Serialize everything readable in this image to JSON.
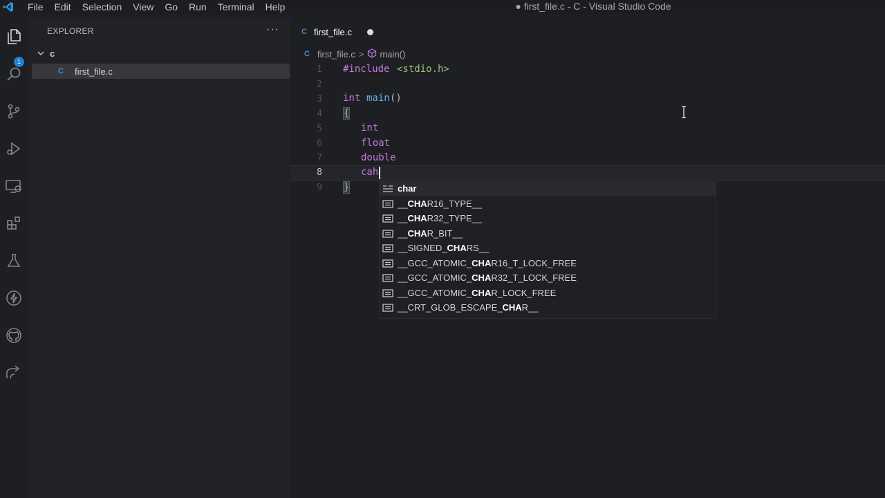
{
  "window": {
    "title": "● first_file.c - C - Visual Studio Code"
  },
  "menu": [
    "File",
    "Edit",
    "Selection",
    "View",
    "Go",
    "Run",
    "Terminal",
    "Help"
  ],
  "activity_bar": {
    "items": [
      "files-icon",
      "search-icon",
      "source-control-icon",
      "run-debug-icon",
      "remote-explorer-icon",
      "extensions-icon",
      "testing-icon",
      "lightning-icon",
      "github-icon",
      "live-share-icon"
    ],
    "explorer_badge": "1"
  },
  "sidebar": {
    "title": "EXPLORER",
    "more": "···",
    "folder": "c",
    "files": [
      {
        "icon_label": "C",
        "name": "first_file.c"
      }
    ]
  },
  "tab": {
    "icon_label": "C",
    "label": "first_file.c"
  },
  "breadcrumb": {
    "icon_label": "C",
    "file": "first_file.c",
    "separator": ">",
    "symbol": "main()"
  },
  "editor": {
    "line_numbers": [
      "1",
      "2",
      "3",
      "4",
      "5",
      "6",
      "7",
      "8",
      "9"
    ],
    "active_line": 8,
    "lines": {
      "l1_directive": "#include",
      "l1_header": "<stdio.h>",
      "l3_type": "int",
      "l3_fn": "main",
      "l3_parens": "()",
      "l4_open": "{",
      "l5": "int",
      "l6": "float",
      "l7": "double",
      "l8": "cah",
      "l9_close": "}"
    }
  },
  "suggestions": {
    "items": [
      {
        "pre": "",
        "match": "char",
        "post": ""
      },
      {
        "pre": "__",
        "match": "CHA",
        "post": "R16_TYPE__"
      },
      {
        "pre": "__",
        "match": "CHA",
        "post": "R32_TYPE__"
      },
      {
        "pre": "__",
        "match": "CHA",
        "post": "R_BIT__"
      },
      {
        "pre": "__SIGNED_",
        "match": "CHA",
        "post": "RS__"
      },
      {
        "pre": "__GCC_ATOMIC_",
        "match": "CHA",
        "post": "R16_T_LOCK_FREE"
      },
      {
        "pre": "__GCC_ATOMIC_",
        "match": "CHA",
        "post": "R32_T_LOCK_FREE"
      },
      {
        "pre": "__GCC_ATOMIC_",
        "match": "CHA",
        "post": "R_LOCK_FREE"
      },
      {
        "pre": "__CRT_GLOB_ESCAPE_",
        "match": "CHA",
        "post": "R__"
      }
    ]
  },
  "colors": {
    "keyword": "#c678dd",
    "function": "#61afef",
    "string": "#98c379",
    "accent": "#1b80d6"
  }
}
